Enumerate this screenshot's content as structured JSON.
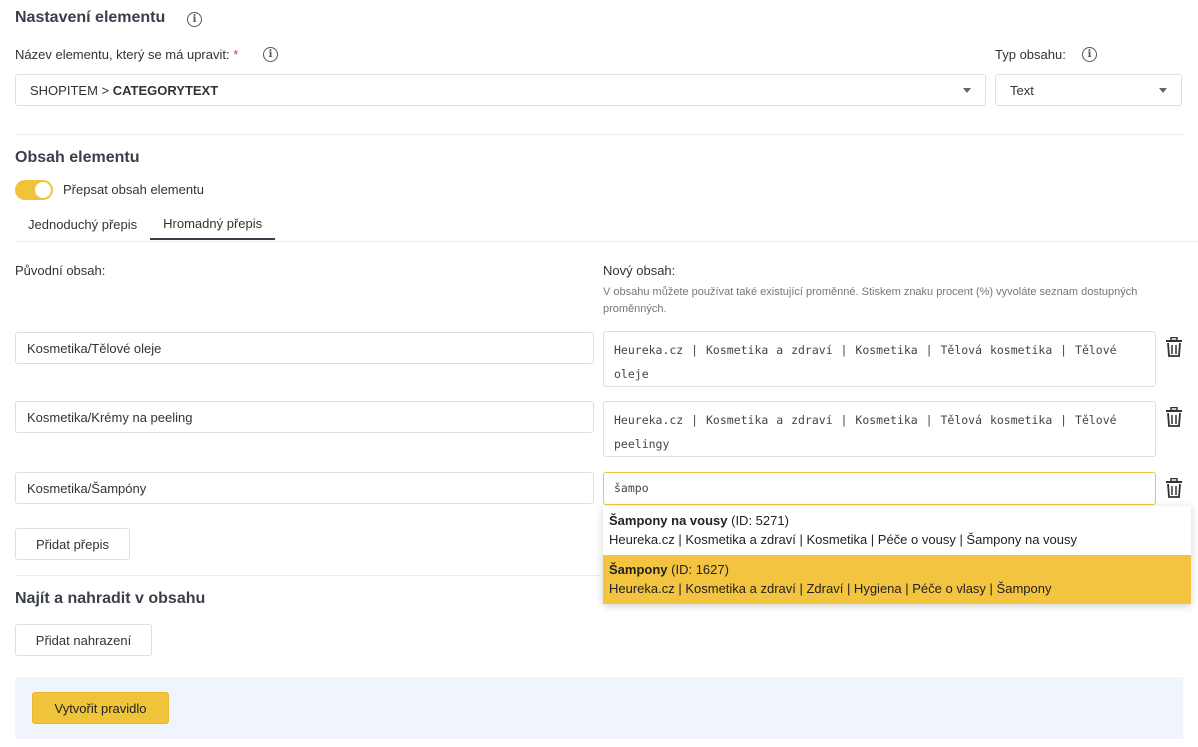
{
  "element_settings": {
    "heading": "Nastavení elementu",
    "name_label": "Název elementu, který se má upravit:",
    "required_mark": "*",
    "name_value_prefix": "SHOPITEM > ",
    "name_value_bold": "CATEGORYTEXT",
    "type_label": "Typ obsahu:",
    "type_value": "Text"
  },
  "element_content": {
    "heading": "Obsah elementu",
    "toggle_label": "Přepsat obsah elementu",
    "toggle_on": true,
    "tabs": [
      {
        "label": "Jednoduchý přepis",
        "active": false
      },
      {
        "label": "Hromadný přepis",
        "active": true
      }
    ],
    "original_label": "Původní obsah:",
    "new_label": "Nový obsah:",
    "new_hint": "V obsahu můžete používat také existující proměnné. Stiskem znaku procent (%) vyvoláte seznam dostupných proměnných.",
    "rows": [
      {
        "original": "Kosmetika/Tělové oleje",
        "new": "Heureka.cz | Kosmetika a zdraví | Kosmetika | Tělová kosmetika | Tělové oleje"
      },
      {
        "original": "Kosmetika/Krémy na peeling",
        "new": "Heureka.cz | Kosmetika a zdraví | Kosmetika | Tělová kosmetika | Tělové peelingy"
      },
      {
        "original": "Kosmetika/Šampóny",
        "new": "šampo"
      }
    ],
    "add_rewrite_button": "Přidat přepis"
  },
  "autocomplete": [
    {
      "title": "Šampony na vousy",
      "id_text": "(ID: 5271)",
      "path": "Heureka.cz | Kosmetika a zdraví | Kosmetika | Péče o vousy | Šampony na vousy",
      "highlighted": false
    },
    {
      "title": "Šampony",
      "id_text": "(ID: 1627)",
      "path": "Heureka.cz | Kosmetika a zdraví | Zdraví | Hygiena | Péče o vlasy | Šampony",
      "highlighted": true
    }
  ],
  "find_replace": {
    "heading": "Najít a nahradit v obsahu",
    "add_button": "Přidat nahrazení"
  },
  "footer": {
    "create_button": "Vytvořit pravidlo"
  },
  "colors": {
    "accent": "#f0c43a",
    "footer_bg": "#f0f5fd"
  }
}
